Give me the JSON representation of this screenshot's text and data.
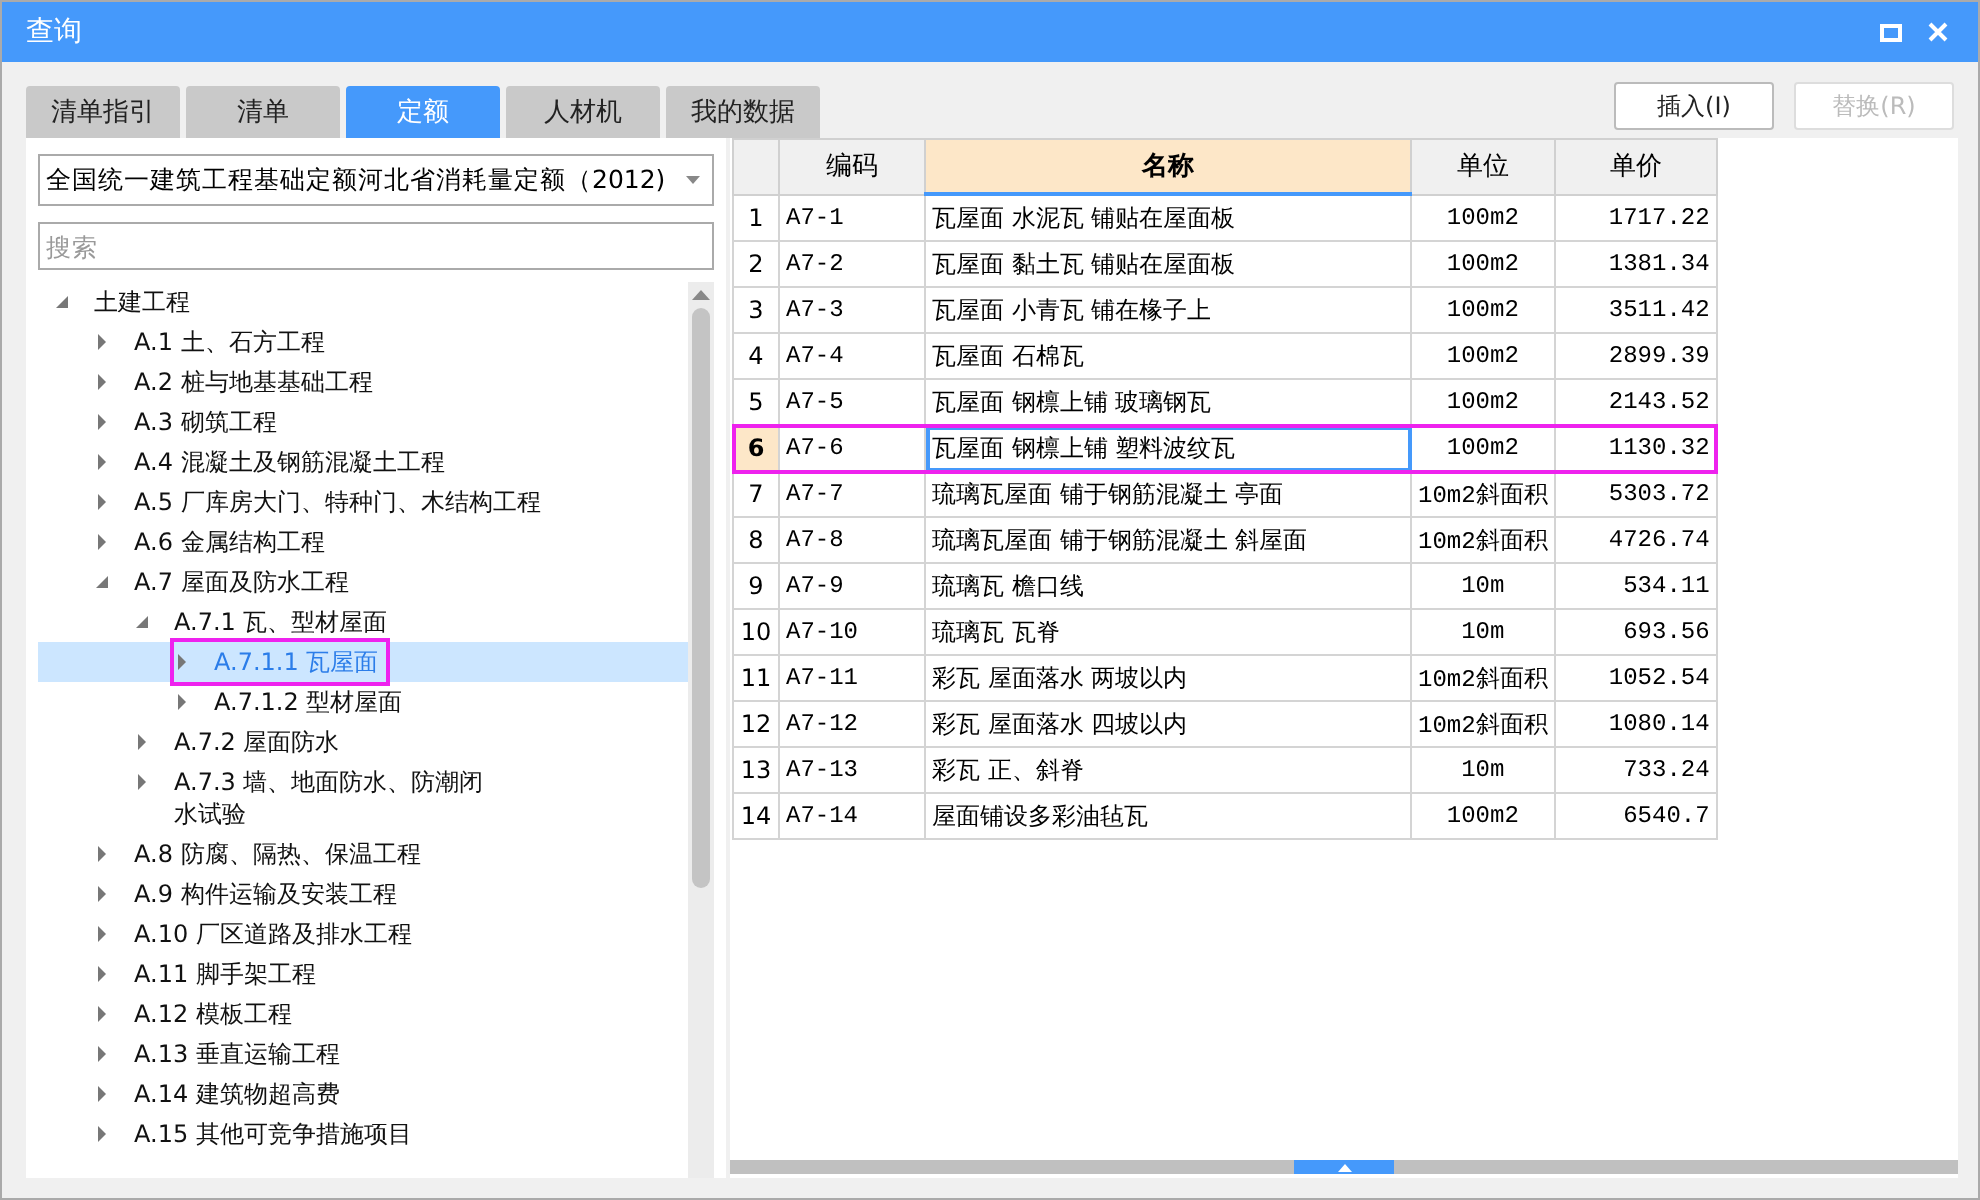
{
  "window": {
    "title": "查询"
  },
  "tabs": [
    {
      "label": "清单指引",
      "selected": false
    },
    {
      "label": "清单",
      "selected": false
    },
    {
      "label": "定额",
      "selected": true
    },
    {
      "label": "人材机",
      "selected": false
    },
    {
      "label": "我的数据",
      "selected": false
    }
  ],
  "buttons": [
    {
      "label": "插入(I)",
      "disabled": false
    },
    {
      "label": "替换(R)",
      "disabled": true
    }
  ],
  "quota_select": {
    "value": "全国统一建筑工程基础定额河北省消耗量定额（2012)"
  },
  "search": {
    "placeholder": "搜索"
  },
  "tree": [
    {
      "label": "土建工程",
      "expanded": true,
      "selected": false,
      "highlighted": false,
      "children": [
        {
          "label": "A.1 土、石方工程",
          "expanded": false,
          "selected": false,
          "highlighted": false
        },
        {
          "label": "A.2 桩与地基基础工程",
          "expanded": false,
          "selected": false,
          "highlighted": false
        },
        {
          "label": "A.3 砌筑工程",
          "expanded": false,
          "selected": false,
          "highlighted": false
        },
        {
          "label": "A.4 混凝土及钢筋混凝土工程",
          "expanded": false,
          "selected": false,
          "highlighted": false
        },
        {
          "label": "A.5 厂库房大门、特种门、木结构工程",
          "expanded": false,
          "selected": false,
          "highlighted": false
        },
        {
          "label": "A.6 金属结构工程",
          "expanded": false,
          "selected": false,
          "highlighted": false
        },
        {
          "label": "A.7 屋面及防水工程",
          "expanded": true,
          "selected": false,
          "highlighted": false,
          "children": [
            {
              "label": "A.7.1 瓦、型材屋面",
              "expanded": true,
              "selected": false,
              "highlighted": false,
              "children": [
                {
                  "label": "A.7.1.1 瓦屋面",
                  "expanded": false,
                  "selected": true,
                  "highlighted": true
                },
                {
                  "label": "A.7.1.2 型材屋面",
                  "expanded": false,
                  "selected": false,
                  "highlighted": false
                }
              ]
            },
            {
              "label": "A.7.2 屋面防水",
              "expanded": false,
              "selected": false,
              "highlighted": false
            },
            {
              "label": "A.7.3 墙、地面防水、防潮闭水试验",
              "expanded": false,
              "selected": false,
              "highlighted": false
            }
          ]
        },
        {
          "label": "A.8 防腐、隔热、保温工程",
          "expanded": false,
          "selected": false,
          "highlighted": false
        },
        {
          "label": "A.9 构件运输及安装工程",
          "expanded": false,
          "selected": false,
          "highlighted": false
        },
        {
          "label": "A.10 厂区道路及排水工程",
          "expanded": false,
          "selected": false,
          "highlighted": false
        },
        {
          "label": "A.11 脚手架工程",
          "expanded": false,
          "selected": false,
          "highlighted": false
        },
        {
          "label": "A.12 模板工程",
          "expanded": false,
          "selected": false,
          "highlighted": false
        },
        {
          "label": "A.13 垂直运输工程",
          "expanded": false,
          "selected": false,
          "highlighted": false
        },
        {
          "label": "A.14 建筑物超高费",
          "expanded": false,
          "selected": false,
          "highlighted": false
        },
        {
          "label": "A.15 其他可竞争措施项目",
          "expanded": false,
          "selected": false,
          "highlighted": false
        }
      ]
    }
  ],
  "table": {
    "columns": [
      "编码",
      "名称",
      "单位",
      "单价"
    ],
    "rows": [
      {
        "index": "1",
        "code": "A7-1",
        "name": "瓦屋面 水泥瓦 铺贴在屋面板",
        "unit": "100m2",
        "price": "1717.22",
        "selected": false,
        "highlighted": false
      },
      {
        "index": "2",
        "code": "A7-2",
        "name": "瓦屋面 黏土瓦 铺贴在屋面板",
        "unit": "100m2",
        "price": "1381.34",
        "selected": false,
        "highlighted": false
      },
      {
        "index": "3",
        "code": "A7-3",
        "name": "瓦屋面 小青瓦 铺在椽子上",
        "unit": "100m2",
        "price": "3511.42",
        "selected": false,
        "highlighted": false
      },
      {
        "index": "4",
        "code": "A7-4",
        "name": "瓦屋面 石棉瓦",
        "unit": "100m2",
        "price": "2899.39",
        "selected": false,
        "highlighted": false
      },
      {
        "index": "5",
        "code": "A7-5",
        "name": "瓦屋面 钢檩上铺 玻璃钢瓦",
        "unit": "100m2",
        "price": "2143.52",
        "selected": false,
        "highlighted": false
      },
      {
        "index": "6",
        "code": "A7-6",
        "name": "瓦屋面 钢檩上铺 塑料波纹瓦",
        "unit": "100m2",
        "price": "1130.32",
        "selected": true,
        "highlighted": true
      },
      {
        "index": "7",
        "code": "A7-7",
        "name": "琉璃瓦屋面 铺于钢筋混凝土 亭面",
        "unit": "10m2斜面积",
        "price": "5303.72",
        "selected": false,
        "highlighted": false
      },
      {
        "index": "8",
        "code": "A7-8",
        "name": "琉璃瓦屋面 铺于钢筋混凝土 斜屋面",
        "unit": "10m2斜面积",
        "price": "4726.74",
        "selected": false,
        "highlighted": false
      },
      {
        "index": "9",
        "code": "A7-9",
        "name": "琉璃瓦 檐口线",
        "unit": "10m",
        "price": "534.11",
        "selected": false,
        "highlighted": false
      },
      {
        "index": "10",
        "code": "A7-10",
        "name": "琉璃瓦 瓦脊",
        "unit": "10m",
        "price": "693.56",
        "selected": false,
        "highlighted": false
      },
      {
        "index": "11",
        "code": "A7-11",
        "name": "彩瓦 屋面落水 两坡以内",
        "unit": "10m2斜面积",
        "price": "1052.54",
        "selected": false,
        "highlighted": false
      },
      {
        "index": "12",
        "code": "A7-12",
        "name": "彩瓦 屋面落水 四坡以内",
        "unit": "10m2斜面积",
        "price": "1080.14",
        "selected": false,
        "highlighted": false
      },
      {
        "index": "13",
        "code": "A7-13",
        "name": "彩瓦 正、斜脊",
        "unit": "10m",
        "price": "733.24",
        "selected": false,
        "highlighted": false
      },
      {
        "index": "14",
        "code": "A7-14",
        "name": "屋面铺设多彩油毡瓦",
        "unit": "100m2",
        "price": "6540.7",
        "selected": false,
        "highlighted": false
      }
    ]
  }
}
